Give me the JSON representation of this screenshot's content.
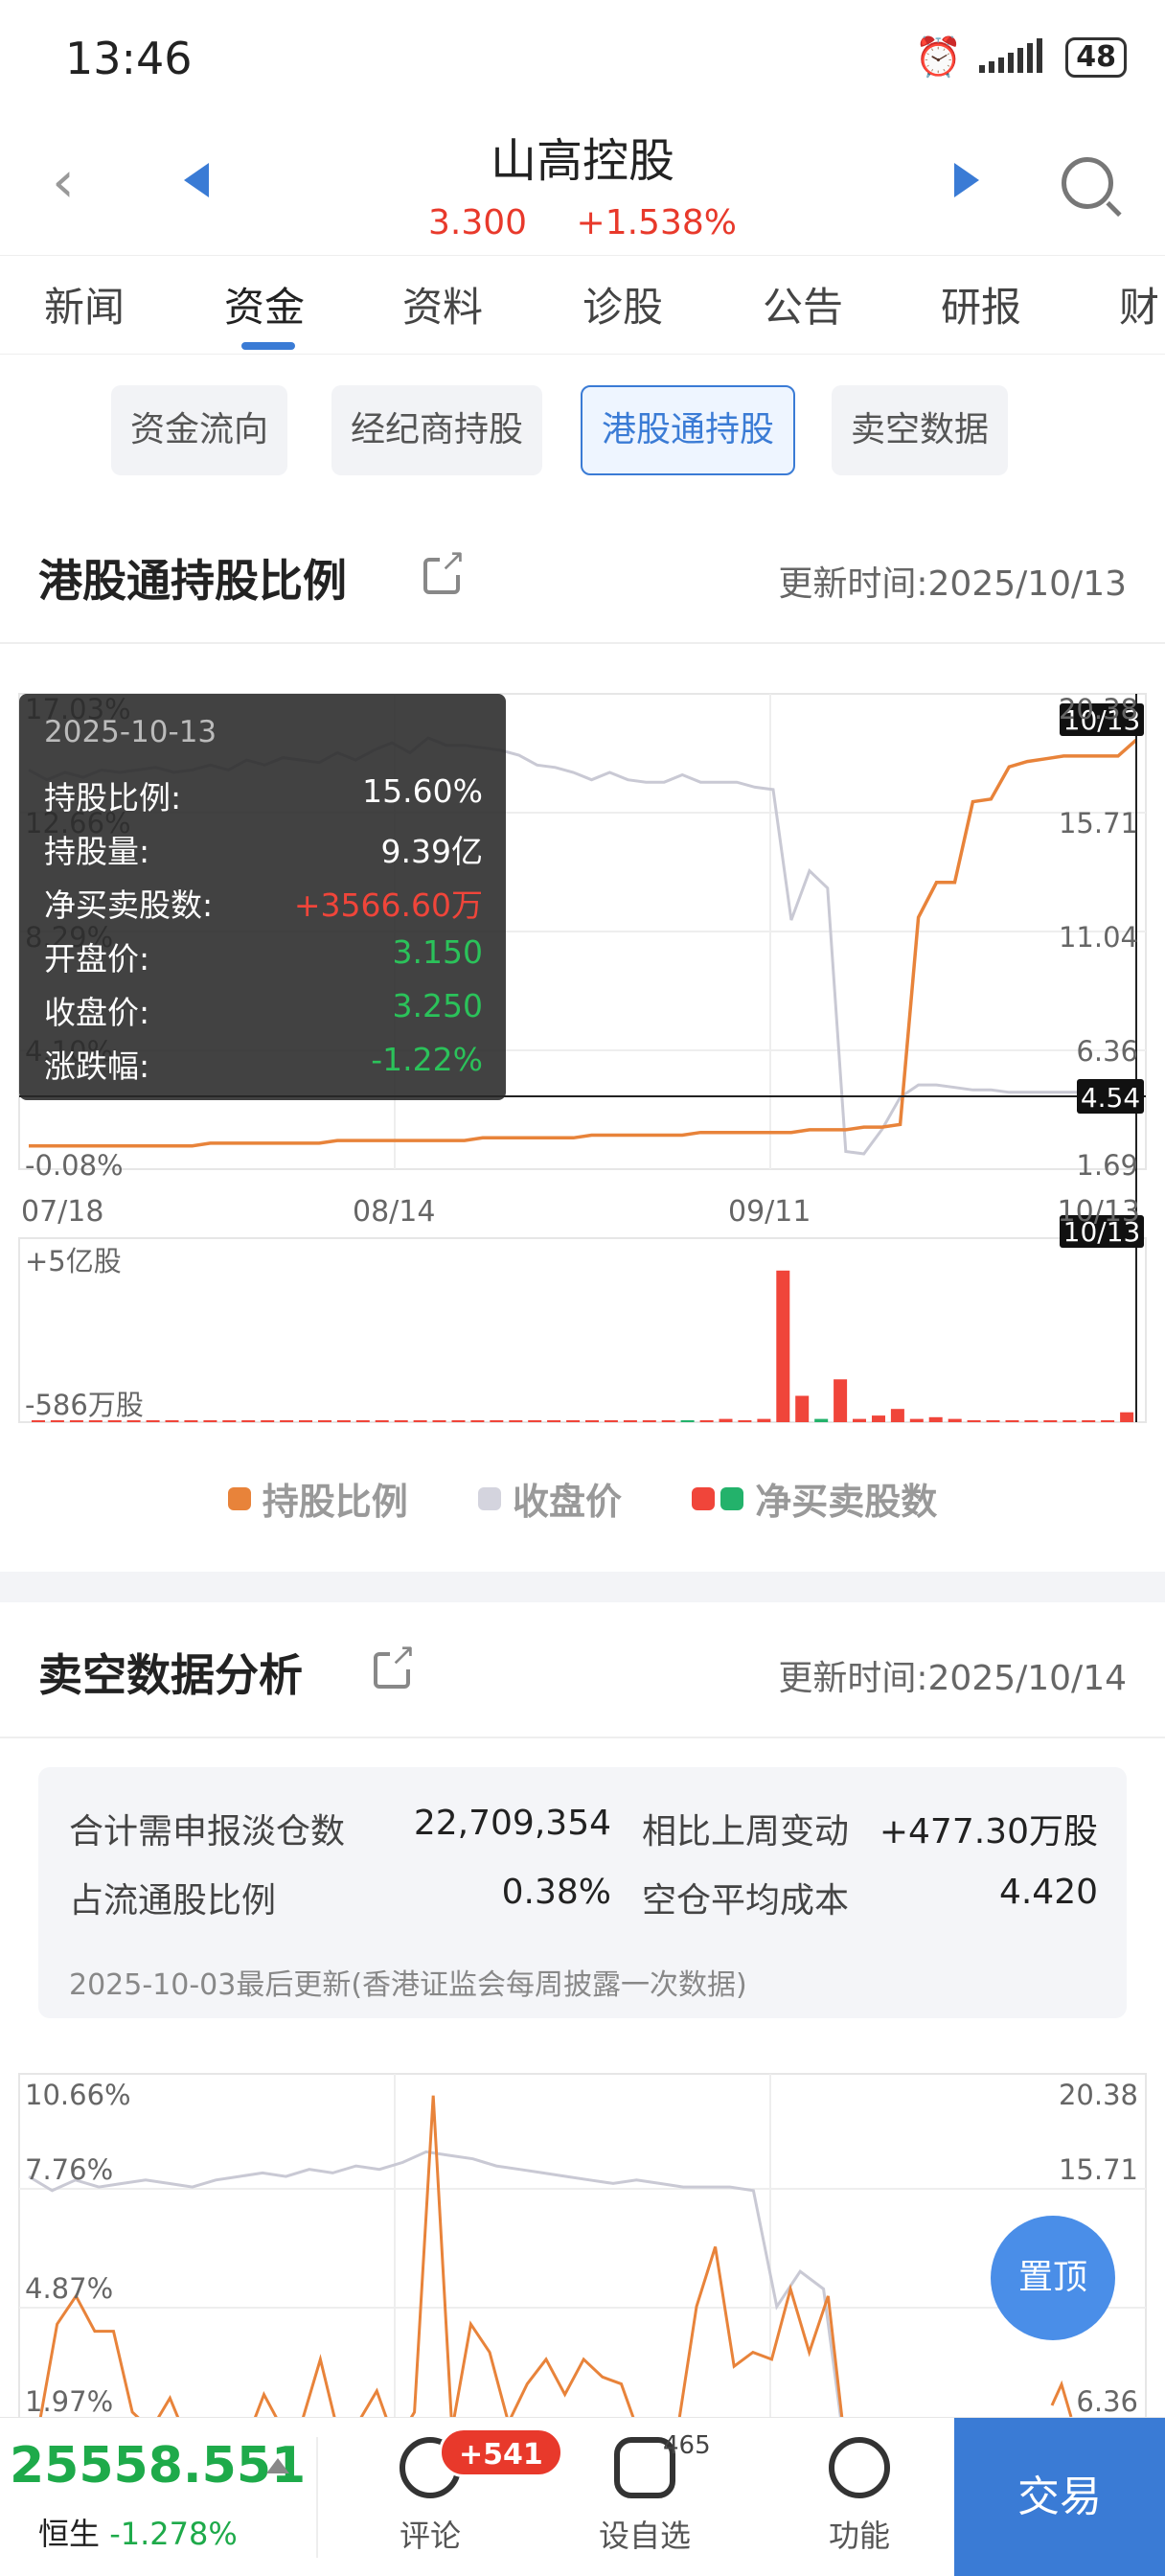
{
  "status": {
    "time": "13:46",
    "battery": "48"
  },
  "header": {
    "title": "山高控股",
    "price": "3.300",
    "change": "+1.538%"
  },
  "tabs": [
    "新闻",
    "资金",
    "资料",
    "诊股",
    "公告",
    "研报",
    "财"
  ],
  "subtabs": [
    "资金流向",
    "经纪商持股",
    "港股通持股",
    "卖空数据"
  ],
  "hk_section": {
    "title": "港股通持股比例",
    "updated": "更新时间:2025/10/13",
    "legend": [
      "持股比例",
      "收盘价",
      "净买卖股数"
    ]
  },
  "chart_data": [
    {
      "type": "line",
      "title": "港股通持股比例",
      "x_ticks": [
        "07/18",
        "08/14",
        "09/11",
        "10/13"
      ],
      "left_axis_ticks": [
        "17.03%",
        "12.66%",
        "8.29%",
        "4.10%",
        "-0.08%"
      ],
      "right_axis_ticks": [
        "20.38",
        "15.71",
        "11.04",
        "6.36",
        "1.69"
      ],
      "ylim_left": [
        -0.08,
        17.03
      ],
      "ylim_right": [
        1.69,
        20.38
      ],
      "series": [
        {
          "name": "持股比例",
          "color": "#e8833a",
          "values": [
            0.5,
            0.5,
            0.5,
            0.5,
            0.5,
            0.5,
            0.5,
            0.5,
            0.5,
            0.5,
            0.6,
            0.6,
            0.6,
            0.6,
            0.6,
            0.6,
            0.6,
            0.7,
            0.7,
            0.7,
            0.7,
            0.7,
            0.7,
            0.7,
            0.7,
            0.8,
            0.8,
            0.8,
            0.8,
            0.8,
            0.8,
            0.9,
            0.9,
            0.9,
            0.9,
            0.9,
            0.9,
            1.0,
            1.0,
            1.0,
            1.0,
            1.0,
            1.0,
            1.1,
            1.1,
            1.1,
            1.2,
            1.2,
            1.3,
            9.0,
            10.3,
            10.3,
            13.3,
            13.4,
            14.6,
            14.8,
            14.9,
            15.0,
            15.0,
            15.0,
            15.0,
            15.6
          ]
        },
        {
          "name": "收盘价",
          "color": "#c9c9d4",
          "values": [
            17.6,
            17.2,
            17.5,
            17.3,
            17.6,
            17.5,
            17.6,
            17.7,
            17.5,
            17.6,
            17.8,
            17.6,
            18.0,
            17.8,
            18.1,
            18.0,
            17.9,
            18.3,
            18.0,
            18.4,
            18.7,
            18.3,
            18.9,
            18.6,
            18.6,
            18.5,
            18.4,
            18.2,
            17.8,
            17.7,
            17.5,
            17.2,
            17.5,
            17.2,
            17.1,
            17.1,
            17.4,
            17.1,
            17.1,
            17.1,
            16.9,
            16.8,
            11.5,
            13.5,
            12.8,
            2.1,
            2.0,
            3.0,
            4.3,
            4.8,
            4.8,
            4.7,
            4.6,
            4.6,
            4.5,
            4.5,
            4.5,
            4.5,
            4.5,
            4.5,
            4.4,
            4.2
          ]
        }
      ],
      "net_buy": {
        "name": "净买卖股数",
        "top_label": "+5亿股",
        "bottom_label": "-586万股",
        "up_color": "#f0453a",
        "down_color": "#23b26b",
        "values": [
          0,
          0,
          0,
          0,
          0.05,
          0,
          0,
          0,
          0,
          0,
          0.02,
          0,
          0.03,
          0.02,
          0.03,
          0.02,
          0.03,
          0.02,
          0.03,
          0.02,
          0.03,
          0.01,
          0.02,
          0,
          0,
          0.02,
          0,
          0.02,
          0.01,
          0.03,
          0,
          0.05,
          0,
          0.05,
          -0.05,
          0.05,
          0.1,
          0,
          0.1,
          4.6,
          0.8,
          -0.1,
          1.3,
          0.1,
          0.2,
          0.4,
          0.1,
          0.15,
          0.1,
          0,
          0,
          0,
          0,
          0,
          0,
          0,
          0,
          0.3
        ]
      },
      "tooltip": {
        "date": "2025-10-13",
        "rows": [
          {
            "label": "持股比例:",
            "value": "15.60%"
          },
          {
            "label": "持股量:",
            "value": "9.39亿"
          },
          {
            "label": "净买卖股数:",
            "value": "+3566.60万"
          },
          {
            "label": "开盘价:",
            "value": "3.150"
          },
          {
            "label": "收盘价:",
            "value": "3.250"
          },
          {
            "label": "涨跌幅:",
            "value": "-1.22%"
          }
        ],
        "cursor_x_label": "10/13",
        "cursor_y_label": "4.54"
      }
    },
    {
      "type": "line",
      "title": "卖空数据分析",
      "left_axis_ticks": [
        "10.66%",
        "7.76%",
        "4.87%",
        "1.97%"
      ],
      "right_axis_ticks": [
        "20.38",
        "15.71",
        "",
        "6.36"
      ],
      "series": [
        {
          "name": "short_ratio",
          "color": "#e8833a",
          "values": [
            1.0,
            4.0,
            4.8,
            3.8,
            3.8,
            1.5,
            1.0,
            1.9,
            0.6,
            0.8,
            1.2,
            0.6,
            2.0,
            1.0,
            1.2,
            3.0,
            0.8,
            1.2,
            2.1,
            0.6,
            1.5,
            10.5,
            1.0,
            4.0,
            3.2,
            1.2,
            2.3,
            3.0,
            2.0,
            3.0,
            2.5,
            2.3,
            0.8,
            1.0,
            1.0,
            4.5,
            6.2,
            2.8,
            3.2,
            3.0,
            5.0,
            3.2,
            4.8,
            0.1
          ]
        },
        {
          "name": "close",
          "color": "#c9c9d4",
          "values": [
            8.2,
            7.8,
            8.1,
            7.9,
            8.0,
            8.1,
            8.0,
            7.9,
            8.1,
            8.2,
            8.3,
            8.2,
            8.4,
            8.3,
            8.5,
            8.4,
            8.6,
            8.9,
            8.8,
            8.7,
            8.5,
            8.4,
            8.3,
            8.2,
            8.1,
            8.0,
            8.1,
            8.0,
            7.9,
            7.9,
            7.9,
            7.8,
            4.5,
            5.5,
            5.0,
            0
          ]
        }
      ]
    }
  ],
  "short_section": {
    "title": "卖空数据分析",
    "updated": "更新时间:2025/10/14",
    "rows": [
      {
        "label1": "合计需申报淡仓数",
        "val1": "22,709,354",
        "label2": "相比上周变动",
        "val2": "+477.30万股"
      },
      {
        "label1": "占流通股比例",
        "val1": "0.38%",
        "label2": "空仓平均成本",
        "val2": "4.420"
      }
    ],
    "note": "2025-10-03最后更新(香港证监会每周披露一次数据)"
  },
  "float_button": "置顶",
  "bottom_bar": {
    "index_value": "25558.551",
    "index_name": "恒生",
    "index_change": "-1.278%",
    "comment_label": "评论",
    "comment_badge": "+541",
    "watch_label": "设自选",
    "watch_count": "465",
    "func_label": "功能",
    "trade_label": "交易"
  }
}
